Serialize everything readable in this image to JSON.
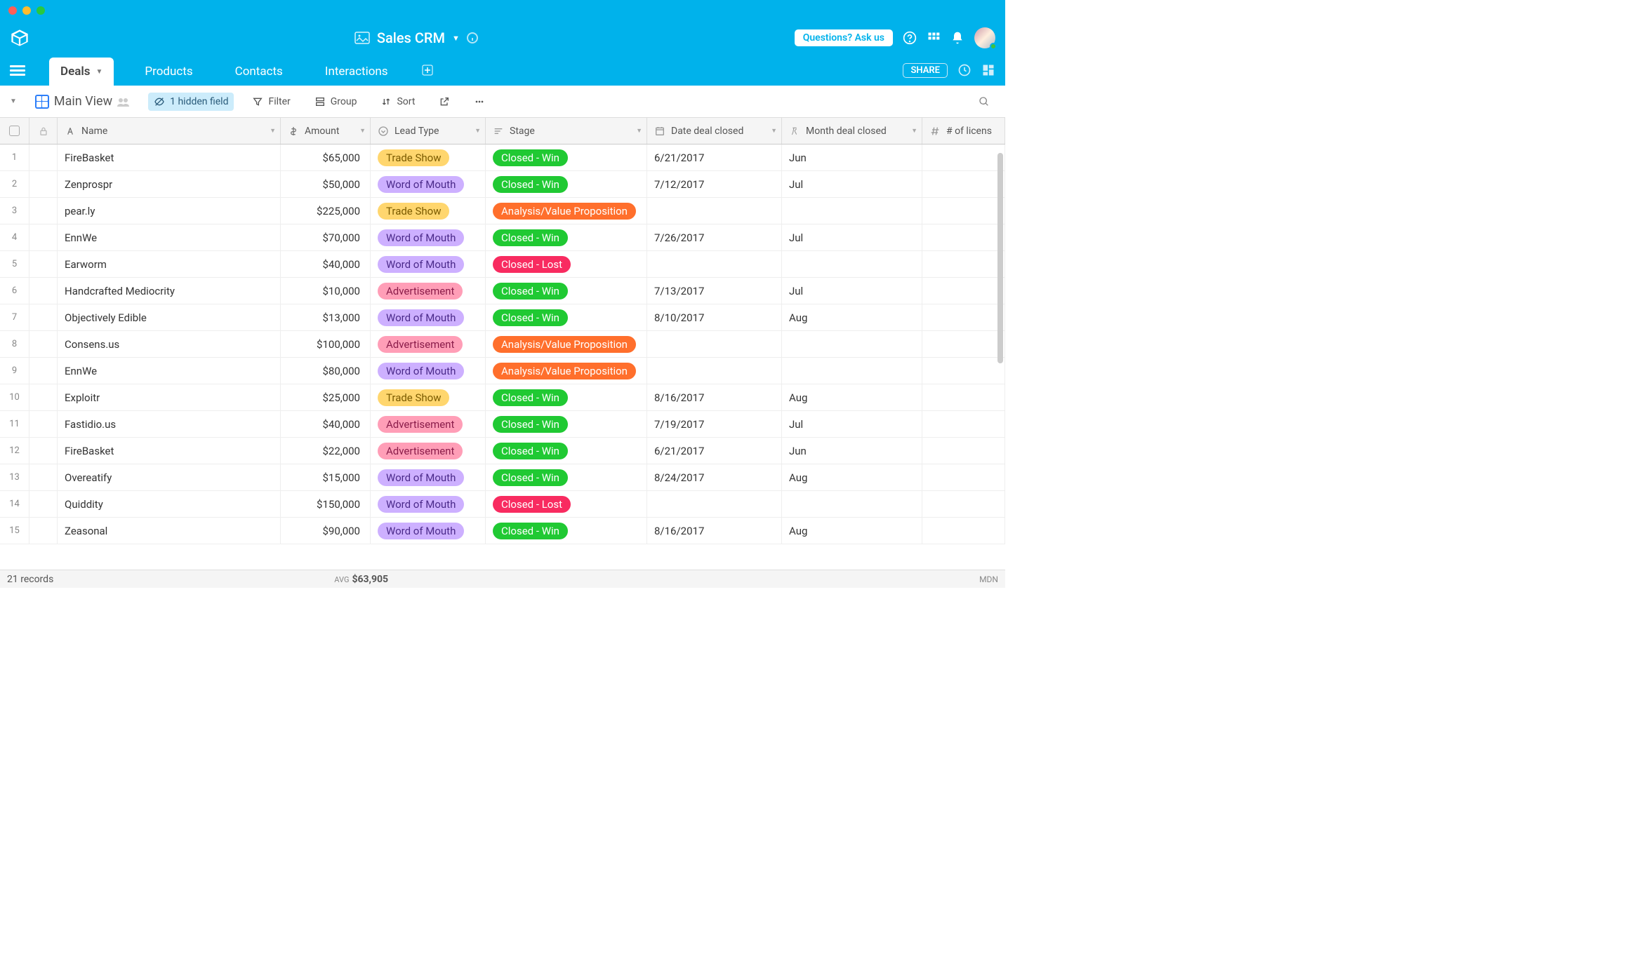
{
  "app_title": "Sales CRM",
  "ask_button": "Questions? Ask us",
  "share_button": "SHARE",
  "tabs": [
    "Deals",
    "Products",
    "Contacts",
    "Interactions"
  ],
  "active_tab": 0,
  "view_name": "Main View",
  "toolbar": {
    "hidden_fields": "1 hidden field",
    "filter": "Filter",
    "group": "Group",
    "sort": "Sort"
  },
  "columns": {
    "name": "Name",
    "amount": "Amount",
    "lead_type": "Lead Type",
    "stage": "Stage",
    "date_closed": "Date deal closed",
    "month_closed": "Month deal closed",
    "licenses": "# of licens"
  },
  "lead_types": {
    "Trade Show": "pill-tradeshow",
    "Word of Mouth": "pill-wom",
    "Advertisement": "pill-advert"
  },
  "stages": {
    "Closed - Win": "pill-closedwin",
    "Closed - Lost": "pill-closedlost",
    "Analysis/Value Proposition": "pill-analysis"
  },
  "rows": [
    {
      "n": 1,
      "name": "FireBasket",
      "amount": "$65,000",
      "lead": "Trade Show",
      "stage": "Closed - Win",
      "date": "6/21/2017",
      "month": "Jun"
    },
    {
      "n": 2,
      "name": "Zenprospr",
      "amount": "$50,000",
      "lead": "Word of Mouth",
      "stage": "Closed - Win",
      "date": "7/12/2017",
      "month": "Jul"
    },
    {
      "n": 3,
      "name": "pear.ly",
      "amount": "$225,000",
      "lead": "Trade Show",
      "stage": "Analysis/Value Proposition",
      "date": "",
      "month": ""
    },
    {
      "n": 4,
      "name": "EnnWe",
      "amount": "$70,000",
      "lead": "Word of Mouth",
      "stage": "Closed - Win",
      "date": "7/26/2017",
      "month": "Jul"
    },
    {
      "n": 5,
      "name": "Earworm",
      "amount": "$40,000",
      "lead": "Word of Mouth",
      "stage": "Closed - Lost",
      "date": "",
      "month": ""
    },
    {
      "n": 6,
      "name": "Handcrafted Mediocrity",
      "amount": "$10,000",
      "lead": "Advertisement",
      "stage": "Closed - Win",
      "date": "7/13/2017",
      "month": "Jul"
    },
    {
      "n": 7,
      "name": "Objectively Edible",
      "amount": "$13,000",
      "lead": "Word of Mouth",
      "stage": "Closed - Win",
      "date": "8/10/2017",
      "month": "Aug"
    },
    {
      "n": 8,
      "name": "Consens.us",
      "amount": "$100,000",
      "lead": "Advertisement",
      "stage": "Analysis/Value Proposition",
      "date": "",
      "month": ""
    },
    {
      "n": 9,
      "name": "EnnWe",
      "amount": "$80,000",
      "lead": "Word of Mouth",
      "stage": "Analysis/Value Proposition",
      "date": "",
      "month": ""
    },
    {
      "n": 10,
      "name": "Exploitr",
      "amount": "$25,000",
      "lead": "Trade Show",
      "stage": "Closed - Win",
      "date": "8/16/2017",
      "month": "Aug"
    },
    {
      "n": 11,
      "name": "Fastidio.us",
      "amount": "$40,000",
      "lead": "Advertisement",
      "stage": "Closed - Win",
      "date": "7/19/2017",
      "month": "Jul"
    },
    {
      "n": 12,
      "name": "FireBasket",
      "amount": "$22,000",
      "lead": "Advertisement",
      "stage": "Closed - Win",
      "date": "6/21/2017",
      "month": "Jun"
    },
    {
      "n": 13,
      "name": "Overeatify",
      "amount": "$15,000",
      "lead": "Word of Mouth",
      "stage": "Closed - Win",
      "date": "8/24/2017",
      "month": "Aug"
    },
    {
      "n": 14,
      "name": "Quiddity",
      "amount": "$150,000",
      "lead": "Word of Mouth",
      "stage": "Closed - Lost",
      "date": "",
      "month": ""
    },
    {
      "n": 15,
      "name": "Zeasonal",
      "amount": "$90,000",
      "lead": "Word of Mouth",
      "stage": "Closed - Win",
      "date": "8/16/2017",
      "month": "Aug"
    }
  ],
  "footer": {
    "records": "21 records",
    "avg_label": "AVG",
    "avg": "$63,905",
    "brand": "MDN"
  }
}
